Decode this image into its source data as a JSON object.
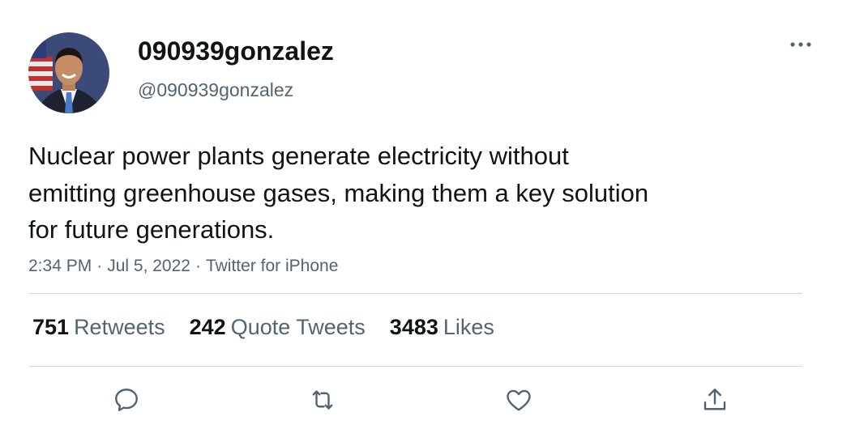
{
  "author": {
    "display_name": "090939gonzalez",
    "handle": "@090939gonzalez"
  },
  "tweet": {
    "text": "Nuclear power plants generate electricity without\nemitting greenhouse gases, making them a key solution\nfor future generations.",
    "time": "2:34 PM",
    "date": "Jul 5, 2022",
    "source": "Twitter for iPhone",
    "separator": "·"
  },
  "stats": {
    "retweets_count": "751",
    "retweets_label": "Retweets",
    "quote_count": "242",
    "quote_label": "Quote Tweets",
    "likes_count": "3483",
    "likes_label": "Likes"
  },
  "icons": {
    "more": "more-horizontal-icon",
    "reply": "reply-icon",
    "retweet": "retweet-icon",
    "like": "heart-icon",
    "share": "share-icon"
  },
  "colors": {
    "text_primary": "#0f1419",
    "text_secondary": "#536471",
    "divider": "#cfd9de"
  }
}
